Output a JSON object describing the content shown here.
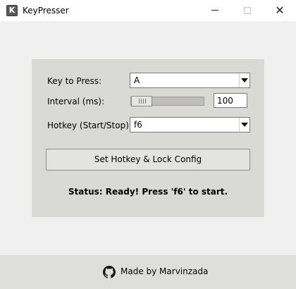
{
  "window": {
    "title": "KeyPresser",
    "icon_letter": "K",
    "icon": "app-k-icon"
  },
  "form": {
    "key_label": "Key to Press:",
    "key_value": "A",
    "interval_label": "Interval (ms):",
    "interval_value": "100",
    "interval_slider_fraction": 0.0,
    "hotkey_label": "Hotkey (Start/Stop):",
    "hotkey_value": "f6"
  },
  "actions": {
    "set_button": "Set Hotkey & Lock Config"
  },
  "status": {
    "text": "Status: Ready! Press 'f6' to start."
  },
  "footer": {
    "text": "Made by Marvinzada",
    "icon": "github-icon"
  }
}
